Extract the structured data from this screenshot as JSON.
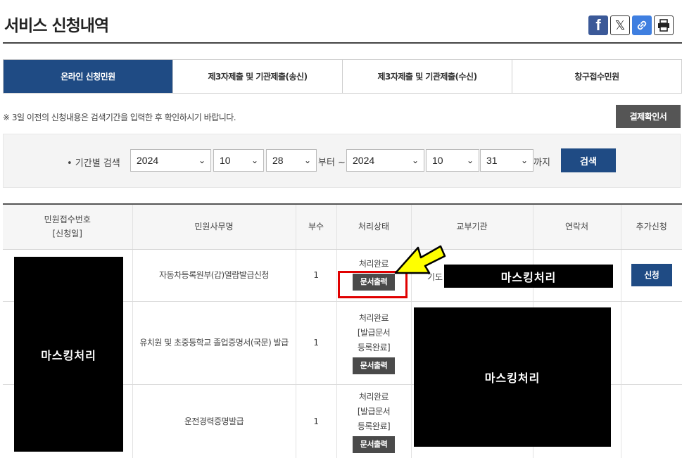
{
  "page": {
    "title": "서비스 신청내역"
  },
  "share": {
    "facebook": "f",
    "x": "𝕏",
    "link": "🔗",
    "print": "print-icon"
  },
  "tabs": [
    {
      "label": "온라인 신청민원",
      "active": true
    },
    {
      "label": "제3자제출 및 기관제출(송신)",
      "active": false
    },
    {
      "label": "제3자제출 및 기관제출(수신)",
      "active": false
    },
    {
      "label": "창구접수민원",
      "active": false
    }
  ],
  "notice": "※ 3일 이전의 신청내용은 검색기간을 입력한 후 확인하시기 바랍니다.",
  "receipt_button": "결제확인서",
  "search": {
    "label": "• 기간별 검색",
    "from": {
      "year": "2024",
      "month": "10",
      "day": "28"
    },
    "from_suffix": "부터 ~",
    "to": {
      "year": "2024",
      "month": "10",
      "day": "31"
    },
    "to_suffix": "까지",
    "button": "검색"
  },
  "table": {
    "headers": {
      "receipt_no": "민원접수번호",
      "apply_date": "[신청일]",
      "name": "민원사무명",
      "copies": "부수",
      "status": "처리상태",
      "agency": "교부기관",
      "contact": "연락처",
      "extra": "추가신청"
    },
    "rows": [
      {
        "name": "자동차등록원부(갑)열람발급신청",
        "copies": "1",
        "status": "처리완료",
        "status_extra1": "",
        "status_extra2": "",
        "doc_button": "문서출력",
        "agency_visible": "기도",
        "apply_button": "신청"
      },
      {
        "name": "유치원 및 초중등학교 졸업증명서(국문) 발급",
        "copies": "1",
        "status": "처리완료",
        "status_extra1": "[발급문서",
        "status_extra2": "등록완료]",
        "doc_button": "문서출력"
      },
      {
        "name": "운전경력증명발급",
        "copies": "1",
        "status": "처리완료",
        "status_extra1": "[발급문서",
        "status_extra2": "등록완료]",
        "doc_button": "문서출력"
      }
    ]
  },
  "masks": {
    "left": "마스킹처리",
    "top_right": "마스킹처리",
    "big_right": "마스킹처리"
  },
  "colors": {
    "primary": "#1f4b84",
    "highlight": "#e00000",
    "arrow": "#ffff00"
  }
}
